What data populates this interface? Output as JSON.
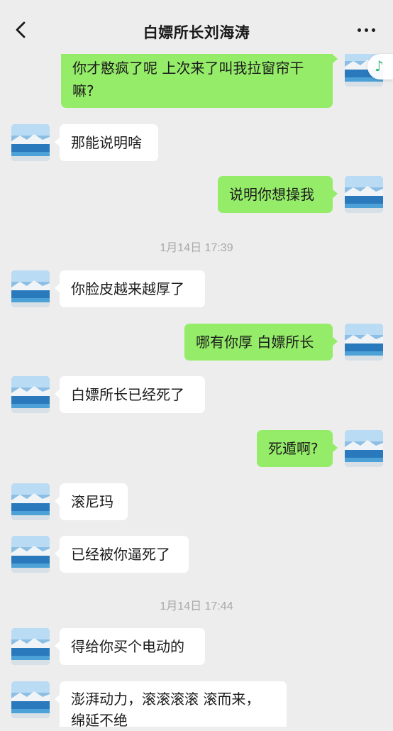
{
  "header": {
    "title": "白嫖所长刘海涛",
    "back_icon": "chevron-left-icon",
    "more_icon": "more-horizontal-icon"
  },
  "floating": {
    "music_icon": "music-note-icon",
    "music_glyph": "♪"
  },
  "messages": [
    {
      "side": "out",
      "text": "你才憨疯了呢 上次来了叫我拉窗帘干\n嘛?"
    },
    {
      "side": "in",
      "text": "那能说明啥"
    },
    {
      "side": "out",
      "text": "说明你想操我"
    },
    {
      "side": "time",
      "text": "1月14日 17:39"
    },
    {
      "side": "in",
      "text": "你脸皮越来越厚了"
    },
    {
      "side": "out",
      "text": "哪有你厚 白嫖所长"
    },
    {
      "side": "in",
      "text": "白嫖所长已经死了"
    },
    {
      "side": "out",
      "text": "死遁啊?"
    },
    {
      "side": "in",
      "text": "滚尼玛"
    },
    {
      "side": "in",
      "text": "已经被你逼死了"
    },
    {
      "side": "time",
      "text": "1月14日 17:44"
    },
    {
      "side": "in",
      "text": "得给你买个电动的"
    },
    {
      "side": "in",
      "text": "澎湃动力，滚滚滚滚 滚而来，\n绵延不绝"
    }
  ],
  "colors": {
    "background": "#ededed",
    "outgoing_bubble": "#95ec69",
    "incoming_bubble": "#ffffff",
    "timestamp": "#a9a9a9"
  }
}
